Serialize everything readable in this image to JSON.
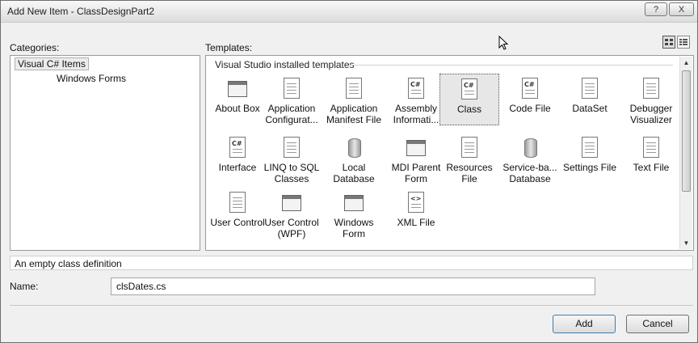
{
  "window": {
    "title": "Add New Item - ClassDesignPart2"
  },
  "title_buttons": {
    "help": "?",
    "close": "X"
  },
  "categories": {
    "label": "Categories:",
    "items": [
      "Visual C# Items",
      "Windows Forms"
    ]
  },
  "templates": {
    "label": "Templates:",
    "group": "Visual Studio installed templates",
    "items": [
      {
        "name": "About Box",
        "line1": "About Box",
        "line2": "",
        "icon": "about-box-icon"
      },
      {
        "name": "Application Configuration",
        "line1": "Application",
        "line2": "Configurat...",
        "icon": "config-icon"
      },
      {
        "name": "Application Manifest File",
        "line1": "Application",
        "line2": "Manifest File",
        "icon": "manifest-icon"
      },
      {
        "name": "Assembly Information",
        "line1": "Assembly",
        "line2": "Informati...",
        "icon": "assembly-icon"
      },
      {
        "name": "Class",
        "line1": "Class",
        "line2": "",
        "icon": "class-icon",
        "selected": true
      },
      {
        "name": "Code File",
        "line1": "Code File",
        "line2": "",
        "icon": "code-file-icon"
      },
      {
        "name": "DataSet",
        "line1": "DataSet",
        "line2": "",
        "icon": "dataset-icon"
      },
      {
        "name": "Debugger Visualizer",
        "line1": "Debugger",
        "line2": "Visualizer",
        "icon": "debugger-icon"
      },
      {
        "name": "Interface",
        "line1": "Interface",
        "line2": "",
        "icon": "interface-icon"
      },
      {
        "name": "LINQ to SQL Classes",
        "line1": "LINQ to SQL",
        "line2": "Classes",
        "icon": "linq-icon"
      },
      {
        "name": "Local Database",
        "line1": "Local",
        "line2": "Database",
        "icon": "database-icon"
      },
      {
        "name": "MDI Parent Form",
        "line1": "MDI Parent",
        "line2": "Form",
        "icon": "mdi-form-icon"
      },
      {
        "name": "Resources File",
        "line1": "Resources",
        "line2": "File",
        "icon": "resources-icon"
      },
      {
        "name": "Service-based Database",
        "line1": "Service-ba...",
        "line2": "Database",
        "icon": "database-icon"
      },
      {
        "name": "Settings File",
        "line1": "Settings File",
        "line2": "",
        "icon": "settings-file-icon"
      },
      {
        "name": "Text File",
        "line1": "Text File",
        "line2": "",
        "icon": "text-file-icon"
      },
      {
        "name": "User Control",
        "line1": "User Control",
        "line2": "",
        "icon": "user-control-icon"
      },
      {
        "name": "User Control (WPF)",
        "line1": "User Control",
        "line2": "(WPF)",
        "icon": "wpf-control-icon"
      },
      {
        "name": "Windows Form",
        "line1": "Windows",
        "line2": "Form",
        "icon": "windows-form-icon"
      },
      {
        "name": "XML File",
        "line1": "XML File",
        "line2": "",
        "icon": "xml-file-icon"
      }
    ]
  },
  "description": "An empty class definition",
  "name_field": {
    "label": "Name:",
    "value": "clsDates.cs"
  },
  "buttons": {
    "add": "Add",
    "cancel": "Cancel"
  }
}
